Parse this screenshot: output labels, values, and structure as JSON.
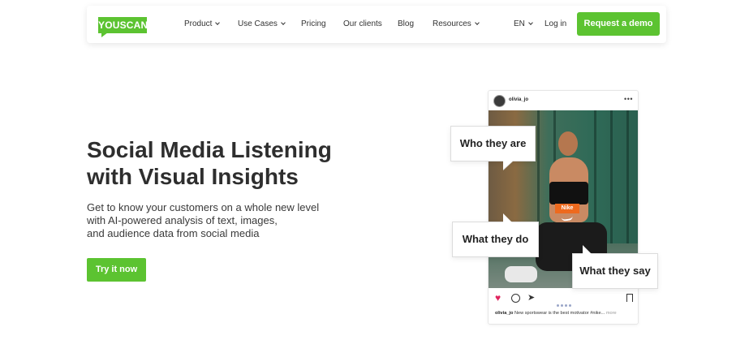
{
  "colors": {
    "brand": "#5cc331",
    "nike_tag": "#ee6a1e",
    "heart": "#e0245e"
  },
  "nav": {
    "logo": "YOUSCAN",
    "items": [
      {
        "label": "Product",
        "dropdown": true
      },
      {
        "label": "Use Cases",
        "dropdown": true
      },
      {
        "label": "Pricing",
        "dropdown": false
      },
      {
        "label": "Our clients",
        "dropdown": false
      },
      {
        "label": "Blog",
        "dropdown": false
      },
      {
        "label": "Resources",
        "dropdown": true
      }
    ],
    "language": "EN",
    "login": "Log in",
    "demo_button": "Request a demo"
  },
  "hero": {
    "title_line1": "Social Media Listening",
    "title_line2": "with Visual Insights",
    "sub_line1": "Get to know your customers on a whole new level",
    "sub_line2": "with AI-powered analysis of text, images,",
    "sub_line3": "and audience data from social media",
    "cta": "Try it now"
  },
  "post": {
    "username": "olivia_jo",
    "menu": "•••",
    "brand_tag": "Nike",
    "caption_user": "olivia_jo",
    "caption_text": "New sportswear is the best motivator #nike...",
    "caption_more": "more",
    "icons": [
      "heart-icon",
      "comment-icon",
      "send-icon",
      "bookmark-icon"
    ]
  },
  "callouts": {
    "who": "Who they are",
    "what_do": "What they do",
    "what_say": "What they say"
  }
}
